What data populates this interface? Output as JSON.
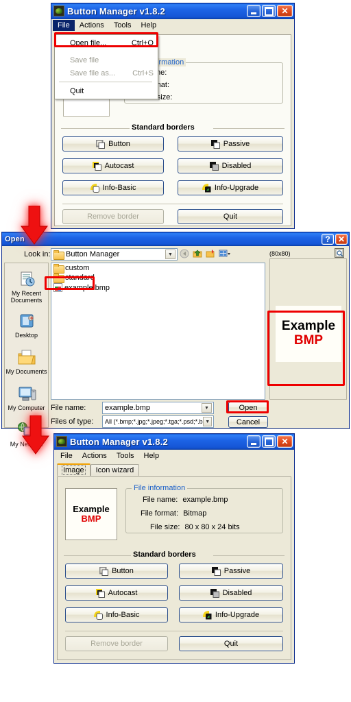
{
  "app": {
    "title": "Button Manager v1.8.2",
    "menus": [
      "File",
      "Actions",
      "Tools",
      "Help"
    ],
    "tabs": [
      {
        "label": "Image",
        "selected": true
      },
      {
        "label": "Icon wizard",
        "selected": false
      }
    ],
    "titlebar_buttons": {
      "minimize": "Minimize",
      "maximize": "Maximize",
      "close": "Close"
    }
  },
  "file_menu": {
    "open_label": "Open file...",
    "open_accel": "Ctrl+O",
    "save_label": "Save file",
    "save_accel": "",
    "saveas_label": "Save file as...",
    "saveas_accel": "Ctrl+S",
    "quit_label": "Quit"
  },
  "file_information": {
    "legend": "File information",
    "name_label": "File name:",
    "format_label": "File format:",
    "size_label": "File size:",
    "name_value_empty": "",
    "format_value_empty": "",
    "size_value_empty": "",
    "name_value": "example.bmp",
    "format_value": "Bitmap",
    "size_value": "80 x 80 x 24 bits"
  },
  "borders": {
    "legend": "Standard borders",
    "items": [
      {
        "label": "Button",
        "icon": "border-button-icon"
      },
      {
        "label": "Passive",
        "icon": "border-passive-icon"
      },
      {
        "label": "Autocast",
        "icon": "border-autocast-icon"
      },
      {
        "label": "Disabled",
        "icon": "border-disabled-icon"
      },
      {
        "label": "Info-Basic",
        "icon": "border-infobasic-icon"
      },
      {
        "label": "Info-Upgrade",
        "icon": "border-infoupgrade-icon"
      }
    ],
    "remove_label": "Remove border",
    "quit_label": "Quit"
  },
  "preview_image": {
    "line1": "Example",
    "line2": "BMP"
  },
  "open_dialog": {
    "title": "Open",
    "lookin_label": "Look in:",
    "lookin_value": "Button Manager",
    "toolbar_icons": [
      "back-icon",
      "up-folder-icon",
      "new-folder-icon",
      "views-icon"
    ],
    "titlebar_buttons": {
      "help": "Help",
      "close": "Close"
    },
    "places": [
      {
        "label": "My Recent Documents",
        "icon": "recent-documents-icon"
      },
      {
        "label": "Desktop",
        "icon": "desktop-icon"
      },
      {
        "label": "My Documents",
        "icon": "my-documents-icon"
      },
      {
        "label": "My Computer",
        "icon": "my-computer-icon"
      },
      {
        "label": "My Network",
        "icon": "my-network-icon"
      }
    ],
    "files": [
      {
        "name": "custom",
        "type": "folder"
      },
      {
        "name": "standard",
        "type": "folder"
      },
      {
        "name": "example.bmp",
        "type": "bitmap"
      }
    ],
    "filename_label": "File name:",
    "filename_value": "example.bmp",
    "filetype_label": "Files of type:",
    "filetype_value": "All (*.bmp;*.jpg;*.jpeg;*.tga;*.psd;*.blp;*.png)",
    "open_button": "Open",
    "cancel_button": "Cancel",
    "preview_size": "(80x80)",
    "preview_toggle_icon": "preview-toggle-icon"
  },
  "annotations": {
    "highlight_color": "#ee0000",
    "arrow_color": "#ee1111",
    "arrow1": "step-arrow-down-1",
    "arrow2": "step-arrow-down-2"
  }
}
